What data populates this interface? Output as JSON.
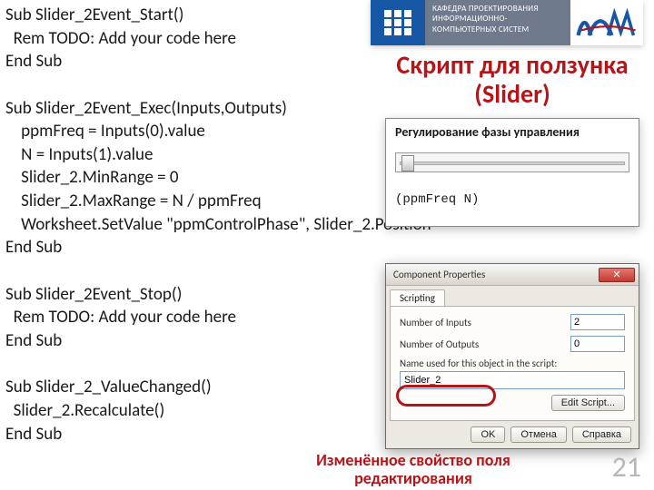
{
  "banner": {
    "line1": "КАФЕДРА ПРОЕКТИРОВАНИЯ",
    "line2": "ИНФОРМАЦИОННО-",
    "line3": "КОМПЬЮТЕРНЫХ СИСТЕМ"
  },
  "title": "Скрипт для ползунка (Slider)",
  "code": "Sub Slider_2Event_Start()\n  Rem TODO: Add your code here\nEnd Sub\n\nSub Slider_2Event_Exec(Inputs,Outputs)\n    ppmFreq = Inputs(0).value\n    N = Inputs(1).value\n    Slider_2.MinRange = 0\n    Slider_2.MaxRange = N / ppmFreq\n    Worksheet.SetValue \"ppmControlPhase\", Slider_2.Position\nEnd Sub\n\nSub Slider_2Event_Stop()\n  Rem TODO: Add your code here\nEnd Sub\n\nSub Slider_2_ValueChanged()\n  Slider_2.Recalculate()\nEnd Sub",
  "phase_panel": {
    "title": "Регулирование фазы управления",
    "expr": "(ppmFreq  N)"
  },
  "props": {
    "window_title": "Component Properties",
    "tab": "Scripting",
    "num_inputs_label": "Number of Inputs",
    "num_inputs_value": "2",
    "num_outputs_label": "Number of Outputs",
    "num_outputs_value": "0",
    "name_label": "Name used for this object in the script:",
    "name_value": "Slider_2",
    "edit_btn": "Edit Script...",
    "ok": "OK",
    "cancel": "Отмена",
    "help": "Справка"
  },
  "red_caption": "Изменённое свойство поля редактирования",
  "page_number": "21"
}
